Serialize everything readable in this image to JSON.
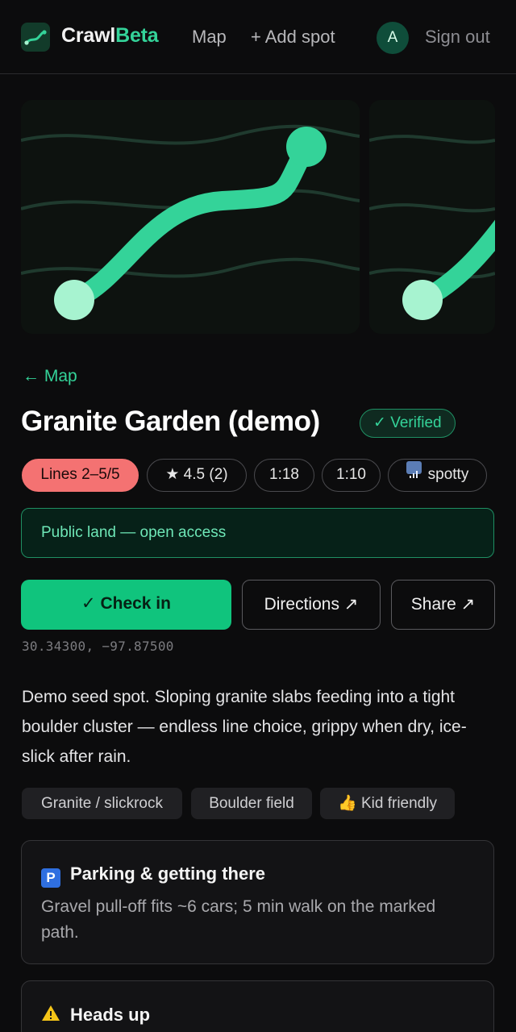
{
  "header": {
    "brand_left": "Crawl",
    "brand_right": "Beta",
    "nav_map": "Map",
    "nav_add": "+ Add spot",
    "avatar_initial": "A",
    "sign_out": "Sign out"
  },
  "spot": {
    "back_link": "← Map",
    "title": "Granite Garden (demo)",
    "verified": "✓ Verified",
    "chips": {
      "lines": "Lines 2–5/5",
      "rating": "★ 4.5 (2)",
      "ratio1": "1:18",
      "ratio2": "1:10",
      "signal": "spotty"
    },
    "access": "Public land — open access",
    "actions": {
      "checkin": "✓ Check in",
      "directions": "Directions ↗",
      "share": "Share ↗"
    },
    "coords": "30.34300, −97.87500",
    "description": "Demo seed spot. Sloping granite slabs feeding into a tight boulder cluster — endless line choice, grippy when dry, ice-slick after rain.",
    "tags": [
      "Granite / slickrock",
      "Boulder field",
      "👍 Kid friendly"
    ],
    "cards": {
      "parking_icon": "P",
      "parking_title": "Parking & getting there",
      "parking_body": "Gravel pull-off fits ~6 cars; 5 min walk on the marked path.",
      "heads_title": "Heads up"
    }
  },
  "colors": {
    "accent": "#34d399",
    "checkin": "#10c47d",
    "lines_chip": "#f47272",
    "background": "#0c0c0d"
  }
}
